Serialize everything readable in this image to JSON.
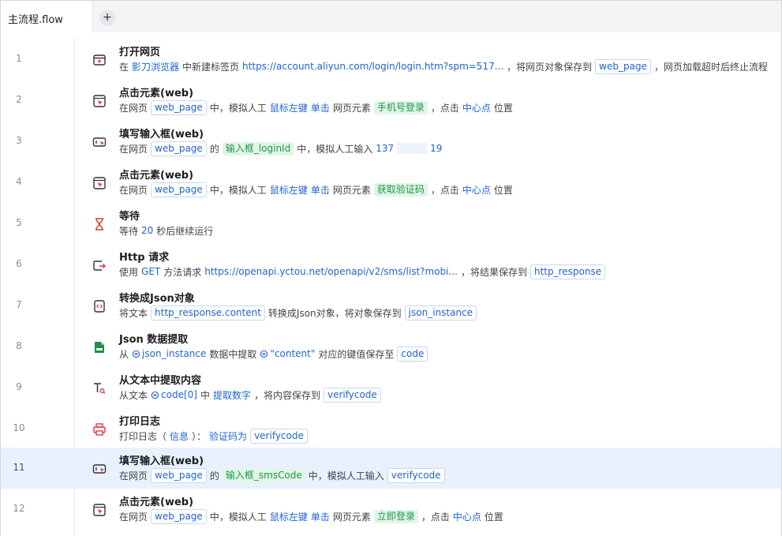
{
  "tab": {
    "title": "主流程.flow",
    "add_label": "+"
  },
  "rows": [
    {
      "num": "1",
      "title": "打开网页",
      "icon": "open-webpage-icon",
      "parts": [
        {
          "k": "t",
          "v": "在"
        },
        {
          "k": "lk",
          "v": "影刀浏览器"
        },
        {
          "k": "t",
          "v": "中新建标签页"
        },
        {
          "k": "lk",
          "v": "https://account.aliyun.com/login/login.htm?spm=517..."
        },
        {
          "k": "t",
          "v": "，将网页对象保存到"
        },
        {
          "k": "box",
          "v": "web_page"
        },
        {
          "k": "t",
          "v": "，网页加载超时后终止流程"
        }
      ]
    },
    {
      "num": "2",
      "title": "点击元素(web)",
      "icon": "click-element-icon",
      "parts": [
        {
          "k": "t",
          "v": "在网页"
        },
        {
          "k": "box",
          "v": "web_page"
        },
        {
          "k": "t",
          "v": "中，模拟人工"
        },
        {
          "k": "lk",
          "v": "鼠标左键"
        },
        {
          "k": "lk",
          "v": "单击"
        },
        {
          "k": "t",
          "v": "网页元素"
        },
        {
          "k": "grn",
          "v": "手机号登录"
        },
        {
          "k": "t",
          "v": "，点击"
        },
        {
          "k": "lk",
          "v": "中心点"
        },
        {
          "k": "t",
          "v": "位置"
        }
      ]
    },
    {
      "num": "3",
      "title": "填写输入框(web)",
      "icon": "fill-input-icon",
      "parts": [
        {
          "k": "t",
          "v": "在网页"
        },
        {
          "k": "box",
          "v": "web_page"
        },
        {
          "k": "t",
          "v": "的"
        },
        {
          "k": "grn",
          "v": "输入框_loginId"
        },
        {
          "k": "t",
          "v": "中，模拟人工输入"
        },
        {
          "k": "lk",
          "v": "137"
        },
        {
          "k": "mask",
          "v": ""
        },
        {
          "k": "lk",
          "v": "19"
        }
      ]
    },
    {
      "num": "4",
      "title": "点击元素(web)",
      "icon": "click-element-icon",
      "parts": [
        {
          "k": "t",
          "v": "在网页"
        },
        {
          "k": "box",
          "v": "web_page"
        },
        {
          "k": "t",
          "v": "中，模拟人工"
        },
        {
          "k": "lk",
          "v": "鼠标左键"
        },
        {
          "k": "lk",
          "v": "单击"
        },
        {
          "k": "t",
          "v": "网页元素"
        },
        {
          "k": "grn",
          "v": "获取验证码"
        },
        {
          "k": "t",
          "v": "，点击"
        },
        {
          "k": "lk",
          "v": "中心点"
        },
        {
          "k": "t",
          "v": "位置"
        }
      ]
    },
    {
      "num": "5",
      "title": "等待",
      "icon": "hourglass-icon",
      "parts": [
        {
          "k": "t",
          "v": "等待"
        },
        {
          "k": "lk",
          "v": "20"
        },
        {
          "k": "t",
          "v": "秒后继续运行"
        }
      ]
    },
    {
      "num": "6",
      "title": "Http 请求",
      "icon": "http-request-icon",
      "parts": [
        {
          "k": "t",
          "v": "使用"
        },
        {
          "k": "lk",
          "v": "GET"
        },
        {
          "k": "t",
          "v": "方法请求"
        },
        {
          "k": "lk",
          "v": "https://openapi.yctou.net/openapi/v2/sms/list?mobi..."
        },
        {
          "k": "t",
          "v": "，将结果保存到"
        },
        {
          "k": "box",
          "v": "http_response"
        }
      ]
    },
    {
      "num": "7",
      "title": "转换成Json对象",
      "icon": "json-convert-icon",
      "parts": [
        {
          "k": "t",
          "v": "将文本"
        },
        {
          "k": "box",
          "v": "http_response.content"
        },
        {
          "k": "t",
          "v": "转换成Json对象，将对象保存到"
        },
        {
          "k": "box",
          "v": "json_instance"
        }
      ]
    },
    {
      "num": "8",
      "title": "Json 数据提取",
      "icon": "json-extract-icon",
      "parts": [
        {
          "k": "t",
          "v": "从"
        },
        {
          "k": "var",
          "v": "json_instance"
        },
        {
          "k": "t",
          "v": "数据中提取"
        },
        {
          "k": "var",
          "v": "\"content\""
        },
        {
          "k": "t",
          "v": "对应的键值保存至"
        },
        {
          "k": "box",
          "v": "code"
        }
      ]
    },
    {
      "num": "9",
      "title": "从文本中提取内容",
      "icon": "text-extract-icon",
      "parts": [
        {
          "k": "t",
          "v": "从文本"
        },
        {
          "k": "var",
          "v": "code[0]"
        },
        {
          "k": "t",
          "v": "中"
        },
        {
          "k": "lk",
          "v": "提取数字"
        },
        {
          "k": "t",
          "v": "，将内容保存到"
        },
        {
          "k": "box",
          "v": "verifycode"
        }
      ]
    },
    {
      "num": "10",
      "title": "打印日志",
      "icon": "printer-icon",
      "parts": [
        {
          "k": "t",
          "v": "打印日志（"
        },
        {
          "k": "lk",
          "v": "信息"
        },
        {
          "k": "t",
          "v": "）："
        },
        {
          "k": "lk",
          "v": "验证码为"
        },
        {
          "k": "box",
          "v": "verifycode"
        }
      ]
    },
    {
      "num": "11",
      "title": "填写输入框(web)",
      "icon": "fill-input-icon",
      "selected": true,
      "parts": [
        {
          "k": "t",
          "v": "在网页"
        },
        {
          "k": "box",
          "v": "web_page"
        },
        {
          "k": "t",
          "v": "的"
        },
        {
          "k": "grn",
          "v": "输入框_smsCode"
        },
        {
          "k": "t",
          "v": "中，模拟人工输入"
        },
        {
          "k": "box",
          "v": "verifycode"
        }
      ]
    },
    {
      "num": "12",
      "title": "点击元素(web)",
      "icon": "click-element-icon",
      "parts": [
        {
          "k": "t",
          "v": "在网页"
        },
        {
          "k": "box",
          "v": "web_page"
        },
        {
          "k": "t",
          "v": "中，模拟人工"
        },
        {
          "k": "lk",
          "v": "鼠标左键"
        },
        {
          "k": "lk",
          "v": "单击"
        },
        {
          "k": "t",
          "v": "网页元素"
        },
        {
          "k": "grn",
          "v": "立即登录"
        },
        {
          "k": "t",
          "v": "，点击"
        },
        {
          "k": "lk",
          "v": "中心点"
        },
        {
          "k": "t",
          "v": "位置"
        }
      ]
    }
  ],
  "colors": {
    "link": "#1f63d6",
    "element_bg": "#e3f5e8",
    "element_text": "#1a9a4a",
    "selected_row": "#e8f1fd"
  }
}
